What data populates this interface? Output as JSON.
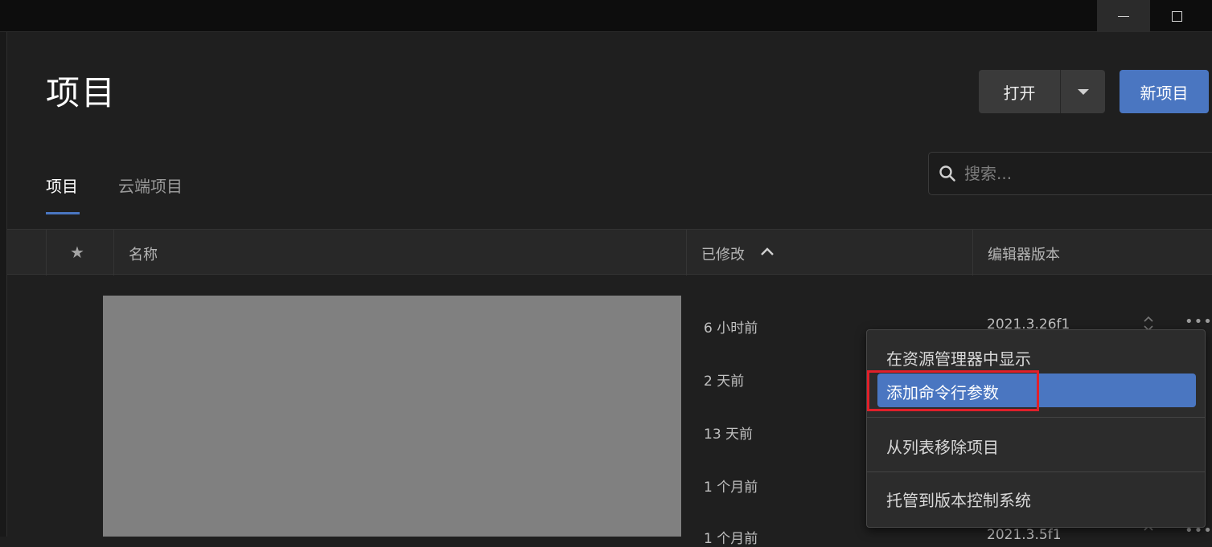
{
  "window": {
    "minimize_icon": "minimize-icon",
    "maximize_icon": "maximize-icon"
  },
  "page": {
    "title": "项目"
  },
  "toolbar": {
    "open_label": "打开",
    "new_project_label": "新项目"
  },
  "tabs": [
    {
      "label": "项目",
      "active": true
    },
    {
      "label": "云端项目",
      "active": false
    }
  ],
  "search": {
    "placeholder": "搜索...",
    "value": ""
  },
  "table": {
    "star_header": "★",
    "columns": {
      "name": "名称",
      "modified": "已修改",
      "editor_version": "编辑器版本"
    },
    "rows": [
      {
        "modified": "6 小时前",
        "version": "2021.3.26f1"
      },
      {
        "modified": "2 天前",
        "version": ""
      },
      {
        "modified": "13 天前",
        "version": ""
      },
      {
        "modified": "1 个月前",
        "version": ""
      },
      {
        "modified": "1 个月前",
        "version": "2021.3.5f1"
      }
    ],
    "more_label": "•••"
  },
  "context_menu": {
    "items": [
      {
        "label": "在资源管理器中显示"
      },
      {
        "label": "添加命令行参数",
        "highlighted": true
      },
      {
        "label": "从列表移除项目"
      },
      {
        "label": "托管到版本控制系统"
      }
    ]
  },
  "colors": {
    "accent": "#4a76c1",
    "annotation_box": "#e0202a",
    "background": "#1f1f1f"
  }
}
